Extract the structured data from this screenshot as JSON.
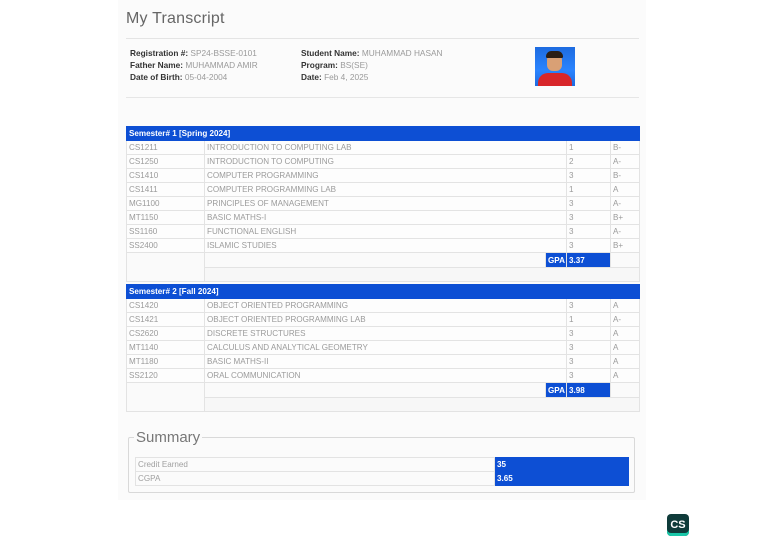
{
  "page_title": "My Transcript",
  "student": {
    "registration_label": "Registration #:",
    "registration": "SP24-BSSE-0101",
    "father_label": "Father Name:",
    "father": "MUHAMMAD AMIR",
    "dob_label": "Date of Birth:",
    "dob": "05-04-2004",
    "name_label": "Student Name:",
    "name": "MUHAMMAD HASAN",
    "program_label": "Program:",
    "program": "BS(SE)",
    "date_label": "Date:",
    "date": "Feb 4, 2025"
  },
  "semesters": [
    {
      "title": "Semester# 1 [Spring 2024]",
      "courses": [
        {
          "code": "CS1211",
          "name": "INTRODUCTION TO COMPUTING LAB",
          "credits": "1",
          "grade": "B-"
        },
        {
          "code": "CS1250",
          "name": "INTRODUCTION TO COMPUTING",
          "credits": "2",
          "grade": "A-"
        },
        {
          "code": "CS1410",
          "name": "COMPUTER PROGRAMMING",
          "credits": "3",
          "grade": "B-"
        },
        {
          "code": "CS1411",
          "name": "COMPUTER PROGRAMMING LAB",
          "credits": "1",
          "grade": "A"
        },
        {
          "code": "MG1100",
          "name": "PRINCIPLES OF MANAGEMENT",
          "credits": "3",
          "grade": "A-"
        },
        {
          "code": "MT1150",
          "name": "BASIC MATHS-I",
          "credits": "3",
          "grade": "B+"
        },
        {
          "code": "SS1160",
          "name": "FUNCTIONAL ENGLISH",
          "credits": "3",
          "grade": "A-"
        },
        {
          "code": "SS2400",
          "name": "ISLAMIC STUDIES",
          "credits": "3",
          "grade": "B+"
        }
      ],
      "gpa_label": "GPA",
      "gpa": "3.37"
    },
    {
      "title": "Semester# 2 [Fall 2024]",
      "courses": [
        {
          "code": "CS1420",
          "name": "OBJECT ORIENTED PROGRAMMING",
          "credits": "3",
          "grade": "A"
        },
        {
          "code": "CS1421",
          "name": "OBJECT ORIENTED PROGRAMMING LAB",
          "credits": "1",
          "grade": "A-"
        },
        {
          "code": "CS2620",
          "name": "DISCRETE STRUCTURES",
          "credits": "3",
          "grade": "A"
        },
        {
          "code": "MT1140",
          "name": "CALCULUS AND ANALYTICAL GEOMETRY",
          "credits": "3",
          "grade": "A"
        },
        {
          "code": "MT1180",
          "name": "BASIC MATHS-II",
          "credits": "3",
          "grade": "A"
        },
        {
          "code": "SS2120",
          "name": "ORAL COMMUNICATION",
          "credits": "3",
          "grade": "A"
        }
      ],
      "gpa_label": "GPA",
      "gpa": "3.98"
    }
  ],
  "summary": {
    "title": "Summary",
    "credit_label": "Credit Earned",
    "credit_value": "35",
    "cgpa_label": "CGPA",
    "cgpa_value": "3.65"
  },
  "watermark": "CS",
  "colors": {
    "header_blue": "#0d4fd4"
  }
}
